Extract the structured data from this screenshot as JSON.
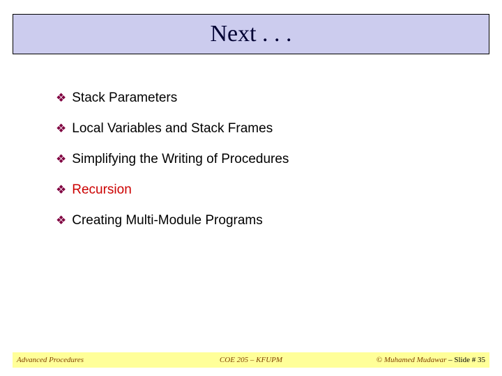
{
  "title": "Next . . .",
  "bullets": [
    {
      "text": "Stack Parameters",
      "highlight": false
    },
    {
      "text": "Local Variables and Stack Frames",
      "highlight": false
    },
    {
      "text": "Simplifying the Writing of Procedures",
      "highlight": false
    },
    {
      "text": "Recursion",
      "highlight": true
    },
    {
      "text": "Creating Multi-Module Programs",
      "highlight": false
    }
  ],
  "footer": {
    "left": "Advanced Procedures",
    "center": "COE 205 – KFUPM",
    "right_copy": "© Muhamed Mudawar",
    "right_slide": " – Slide # 35"
  }
}
